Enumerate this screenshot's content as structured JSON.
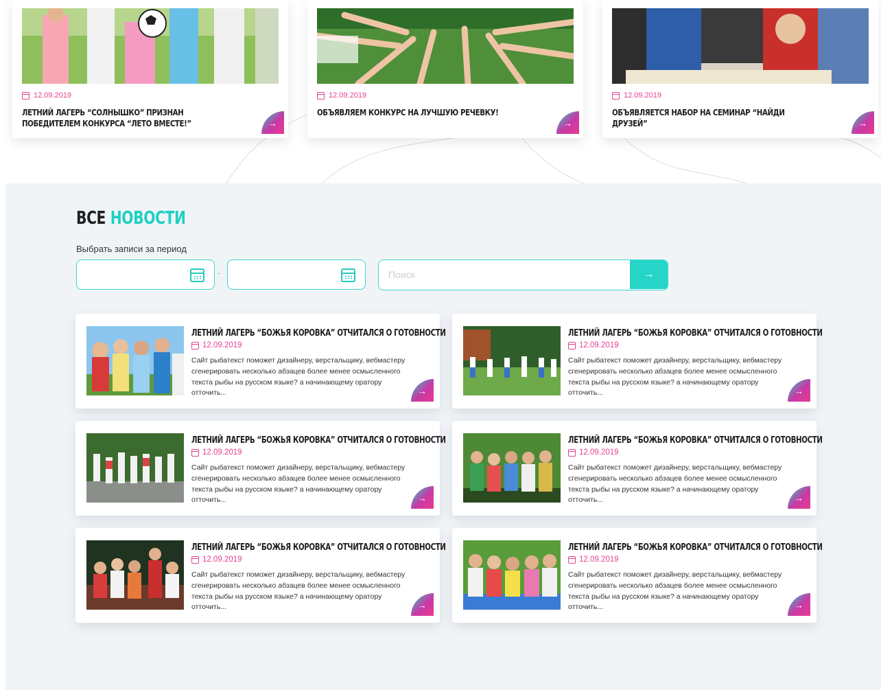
{
  "top_news": [
    {
      "date": "12.09.2019",
      "title": "Летний лагерь “Солнышко” признан победителем конкурса “Лето вместе!”"
    },
    {
      "date": "12.09.2019",
      "title": "Объявляем конкурс на лучшую речевку!"
    },
    {
      "date": "12.09.2019",
      "title": "Объявляется набор на семинар “Найди друзей”"
    }
  ],
  "all_news": {
    "title_part1": "Все",
    "title_part2": "новости",
    "period_label": "Выбрать записи за период",
    "date_separator": "-",
    "search_placeholder": "Поиск",
    "items": [
      {
        "title": "Летний лагерь “Божья коровка” отчитался о готовности",
        "date": "12.09.2019",
        "text": "Сайт рыбатекст поможет дизайнеру, верстальщику, вебмастеру сгенерировать несколько абзацев более менее осмысленного текста рыбы на русском языке? а начинающему оратору отточить..."
      },
      {
        "title": "Летний лагерь “Божья коровка” отчитался о готовности",
        "date": "12.09.2019",
        "text": "Сайт рыбатекст поможет дизайнеру, верстальщику, вебмастеру сгенерировать несколько абзацев более менее осмысленного текста рыбы на русском языке? а начинающему оратору отточить..."
      },
      {
        "title": "Летний лагерь “Божья коровка” отчитался о готовности",
        "date": "12.09.2019",
        "text": "Сайт рыбатекст поможет дизайнеру, верстальщику, вебмастеру сгенерировать несколько абзацев более менее осмысленного текста рыбы на русском языке? а начинающему оратору отточить..."
      },
      {
        "title": "Летний лагерь “Божья коровка” отчитался о готовности",
        "date": "12.09.2019",
        "text": "Сайт рыбатекст поможет дизайнеру, верстальщику, вебмастеру сгенерировать несколько абзацев более менее осмысленного текста рыбы на русском языке? а начинающему оратору отточить..."
      },
      {
        "title": "Летний лагерь “Божья коровка” отчитался о готовности",
        "date": "12.09.2019",
        "text": "Сайт рыбатекст поможет дизайнеру, верстальщику, вебмастеру сгенерировать несколько абзацев более менее осмысленного текста рыбы на русском языке? а начинающему оратору отточить..."
      },
      {
        "title": "Летний лагерь “Божья коровка” отчитался о готовности",
        "date": "12.09.2019",
        "text": "Сайт рыбатекст поможет дизайнеру, верстальщику, вебмастеру сгенерировать несколько абзацев более менее осмысленного текста рыбы на русском языке? а начинающему оратору отточить..."
      }
    ]
  },
  "icons": {
    "date": "calendar-icon",
    "date_picker": "calendar-icon",
    "search_submit": "arrow-right-icon",
    "card_link": "arrow-right-icon"
  },
  "colors": {
    "accent_teal": "#1ed0c2",
    "accent_pink": "#e5408f",
    "section_bg": "#f1f4f7"
  }
}
